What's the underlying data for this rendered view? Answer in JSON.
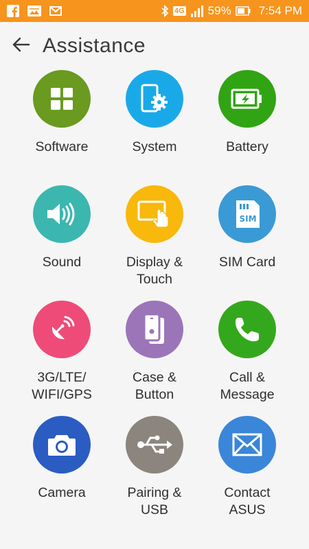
{
  "status_bar": {
    "time": "7:54 PM",
    "battery_percent": "59%",
    "network": "4G",
    "left_icons": [
      "facebook-icon",
      "gallery-icon",
      "mail-icon"
    ],
    "right_icons": [
      "bluetooth-icon",
      "network-4g-icon",
      "signal-icon",
      "battery-icon"
    ],
    "color": "#f7941d"
  },
  "header": {
    "title": "Assistance",
    "back_icon": "arrow-left-icon"
  },
  "tiles": [
    {
      "label": "Software",
      "color": "#6a9a1f",
      "icon": "apps-grid-icon"
    },
    {
      "label": "System",
      "color": "#1aa9e8",
      "icon": "phone-settings-icon"
    },
    {
      "label": "Battery",
      "color": "#30a413",
      "icon": "battery-charging-icon"
    },
    {
      "label": "Sound",
      "color": "#3bb7b0",
      "icon": "speaker-icon"
    },
    {
      "label": "Display &\nTouch",
      "color": "#f8b80c",
      "icon": "touch-screen-icon"
    },
    {
      "label": "SIM Card",
      "color": "#3a9ad5",
      "icon": "sim-card-icon"
    },
    {
      "label": "3G/LTE/\nWIFI/GPS",
      "color": "#ee4b78",
      "icon": "satellite-dish-icon"
    },
    {
      "label": "Case &\nButton",
      "color": "#9b75b8",
      "icon": "phone-case-icon"
    },
    {
      "label": "Call &\nMessage",
      "color": "#34a81c",
      "icon": "phone-call-icon"
    },
    {
      "label": "Camera",
      "color": "#2a5cc2",
      "icon": "camera-icon"
    },
    {
      "label": "Pairing &\nUSB",
      "color": "#8b857d",
      "icon": "usb-icon"
    },
    {
      "label": "Contact\nASUS",
      "color": "#3a86d9",
      "icon": "envelope-icon"
    }
  ]
}
